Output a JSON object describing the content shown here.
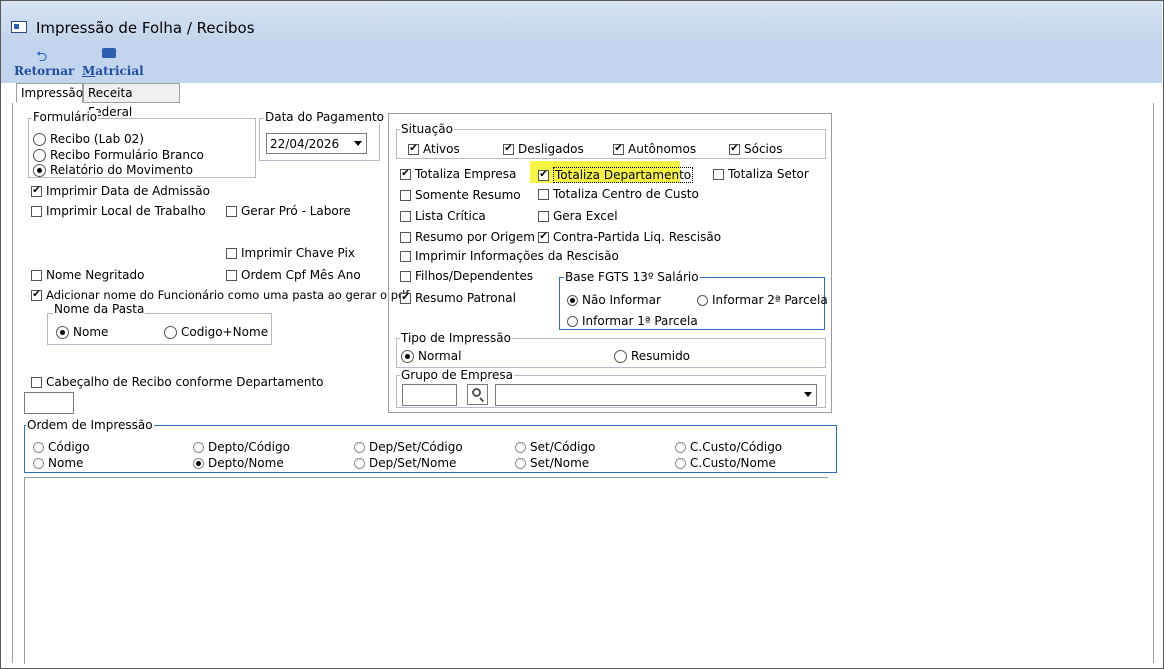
{
  "window": {
    "title": "Impressão de Folha / Recibos"
  },
  "toolbar": {
    "retornar_label": "Retornar",
    "matricial_prefix": "M",
    "matricial_rest": "atricial"
  },
  "tabs": [
    {
      "label": "Impressão"
    },
    {
      "label": "Receita Federal"
    }
  ],
  "formulario": {
    "title": "Formulário",
    "options": [
      "Recibo (Lab 02)",
      "Recibo Formulário Branco",
      "Relatório do Movimento"
    ],
    "selected": "Relatório do Movimento"
  },
  "data_pagamento": {
    "title": "Data do Pagamento",
    "value": "22/04/2026"
  },
  "left_checks": {
    "imprimir_admissao": {
      "label": "Imprimir Data de Admissão",
      "checked": true
    },
    "imprimir_local": {
      "label": "Imprimir Local de Trabalho",
      "checked": false
    },
    "gerar_pro_labore": {
      "label": "Gerar Pró - Labore",
      "checked": false
    },
    "imprimir_chave_pix": {
      "label": "Imprimir Chave Pix",
      "checked": false
    },
    "nome_negritado": {
      "label": "Nome Negritado",
      "checked": false
    },
    "ordem_cpf": {
      "label": "Ordem Cpf Mês Ano",
      "checked": false
    },
    "adicionar_nome": {
      "label": "Adicionar nome do Funcionário como uma pasta ao gerar o pdf",
      "checked": true
    },
    "cabecalho_recibo": {
      "label": "Cabeçalho de Recibo conforme Departamento",
      "checked": false
    }
  },
  "nome_pasta": {
    "title": "Nome da Pasta",
    "options": [
      "Nome",
      "Codigo+Nome"
    ],
    "selected": "Nome"
  },
  "situacao": {
    "title": "Situação",
    "items": [
      {
        "label": "Ativos",
        "checked": true
      },
      {
        "label": "Desligados",
        "checked": true
      },
      {
        "label": "Autônomos",
        "checked": true
      },
      {
        "label": "Sócios",
        "checked": true
      }
    ]
  },
  "right_checks": {
    "totaliza_empresa": {
      "label": "Totaliza Empresa",
      "checked": true
    },
    "totaliza_departamento": {
      "label": "Totaliza Departamento",
      "checked": true
    },
    "totaliza_setor": {
      "label": "Totaliza Setor",
      "checked": false
    },
    "somente_resumo": {
      "label": "Somente Resumo",
      "checked": false
    },
    "totaliza_centro_custo": {
      "label": "Totaliza Centro de Custo",
      "checked": false
    },
    "lista_critica": {
      "label": "Lista Crítica",
      "checked": false
    },
    "gera_excel": {
      "label": "Gera Excel",
      "checked": false
    },
    "resumo_origem": {
      "label": "Resumo por Origem",
      "checked": false
    },
    "contra_partida": {
      "label": "Contra-Partida Liq. Rescisão",
      "checked": true
    },
    "imprimir_info_rescisao": {
      "label": "Imprimir Informações da Rescisão",
      "checked": false
    },
    "filhos_dependentes": {
      "label": "Filhos/Dependentes",
      "checked": false
    },
    "resumo_patronal": {
      "label": "Resumo Patronal",
      "checked": true
    }
  },
  "base_fgts": {
    "title": "Base FGTS 13º Salário",
    "options": [
      "Não Informar",
      "Informar 2ª Parcela",
      "Informar 1ª Parcela"
    ],
    "selected": "Não Informar"
  },
  "tipo_impressao": {
    "title": "Tipo de Impressão",
    "options": [
      "Normal",
      "Resumido"
    ],
    "selected": "Normal"
  },
  "grupo_empresa": {
    "title": "Grupo de Empresa",
    "code_value": "",
    "select_value": ""
  },
  "ordem_impressao": {
    "title": "Ordem de Impressão",
    "row1": [
      "Código",
      "Depto/Código",
      "Dep/Set/Código",
      "Set/Código",
      "C.Custo/Código"
    ],
    "row2": [
      "Nome",
      "Depto/Nome",
      "Dep/Set/Nome",
      "Set/Nome",
      "C.Custo/Nome"
    ],
    "selected": "Depto/Nome"
  },
  "colors": {
    "titlebar": "#c3d5ec",
    "highlight": "#f5f542",
    "accent_border": "#2c6fbf",
    "toolbar_text": "#1f4fa3"
  }
}
